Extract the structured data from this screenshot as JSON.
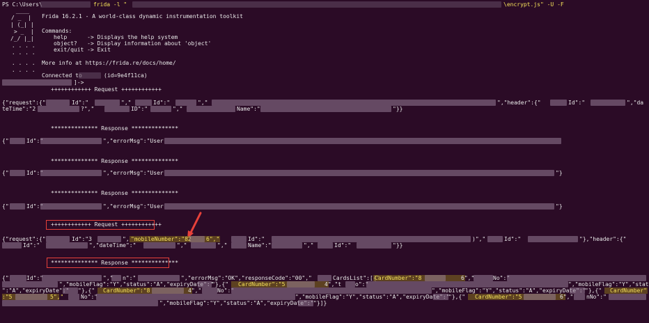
{
  "terminal": {
    "prompt": "PS C:\\Users\\",
    "cmd_frida": "frida -l \"",
    "cmd_script": "\\encrypt.js\" -U -F",
    "logo": [
      " ____",
      "/ _  |",
      "| (_| |",
      " > _  |",
      "/_/ |_|",
      " . . . .",
      " . . . .",
      " . . . .",
      " . . . ."
    ],
    "banner": "Frida 16.2.1 - A world-class dynamic instrumentation toolkit",
    "commands_header": "Commands:",
    "cmd_help": "help      -> Displays the help system",
    "cmd_object": "object?   -> Display information about 'object'",
    "cmd_exit": "exit/quit -> Exit",
    "more_info": "More info at https://frida.re/docs/home/",
    "connected": "Connected to",
    "connected_id": "(id=9e4f11ca)",
    "device_prompt": "]->",
    "request_header": "++++++++++++ Request ++++++++++++",
    "response_header": "************** Response **************",
    "req1_a": "{\"request\":{\"",
    "req1_b": "Id\":\"",
    "req1_c": "\",\"",
    "req1_d": "Id\":\"",
    "req1_e": "\",\"",
    "req1_f": "\",\"header\":{\"",
    "req1_g": "Id\":\"",
    "req1_h": "\",\"da",
    "req1_line2a": "teTime\":\"2",
    "req1_line2b": "?\",\"",
    "req1_line2c": "ID\":\"",
    "req1_line2d": "\",\"",
    "req1_line2e": "Name\":\"",
    "req1_line2f": "\"}}",
    "resp_a": "{\"",
    "resp_b": "Id\":\"",
    "resp_c": "\",\"errorMsg\":\"User",
    "resp_end": "\"}",
    "req2_a": "{\"request\":{\"",
    "req2_b": "Id\":\"3",
    "req2_c": "\",",
    "req2_mobile": "\"mobileNumber\":\"82",
    "req2_mobile_end": "6\",\"",
    "req2_d": "Id\":\"",
    "req2_e": ")\",\"",
    "req2_f": "Id\":\"",
    "req2_g": "\"},\"header\":{\"",
    "req2_line2a": "Id\":\"",
    "req2_line2b": "\",\"dateTime\":\"",
    "req2_line2c": "\",\"",
    "req2_line2d": "\",\"",
    "req2_line2e": "Name\":\"",
    "req2_line2f": "\",\"",
    "req2_line2g": "Id\":\"",
    "req2_line2h": "\"}}",
    "resp4_a": "{\"",
    "resp4_b": "Id\":\"",
    "resp4_c": "\",\"",
    "resp4_d": "n\":\"",
    "resp4_e": "\",\"errorMsg\":\"OK\",\"responseCode\":\"00\",\"",
    "resp4_f": "CardsList\":[{\"",
    "card_label": "CardNumber\":\"8",
    "card_end_6": "6\",\"",
    "no_label": "No\":\"",
    "l2_a": "\",\"mobileFlag\":\"Y\",\"status\":\"A\",\"expiryDate\":\"",
    "l2_b": "\"},{\"",
    "card_5": "CardNumber\":\"5",
    "card_4": "4\",\"t",
    "l2_c": "o\":\"",
    "l2_d": "\",\"mobileFlag\":\"Y\",\"status",
    "l3_a": "\":\"A\",\"expiryDate\":\"",
    "l3_b": "\"},{\"",
    "card_8b": "CardNumber\":\"8",
    "card_4b": "4\",\"",
    "l3_c": "No\":\"",
    "l3_d": "\",\"mobileFlag\":\"Y\",\"status\":\"A\",\"expiryDate\":\"",
    "l3_e": "\"},{\"",
    "l3_card": "CardNumber\"",
    "l4_a": ":\"5",
    "l4_b": "5\",\"",
    "l4_c": "No\":\"",
    "l4_d": "\",\"mobileFlag\":\"Y\",\"status\":\"A\",\"expiryDate\":\"",
    "l4_e": "\"},{\"",
    "card_5c": "CardNumber\":\"5",
    "card_6c": "6\",\"",
    "l4_f": "nNo\":\"",
    "l5_a": "\",\"mobileFlag\":\"Y\",\"status\":\"A\",\"expiryDate\":\"",
    "l5_b": "\"}]}"
  },
  "colors": {
    "background": "#2b0b26",
    "text": "#e8e8e8",
    "highlight": "#f5e25a",
    "annotation": "#e8413a"
  }
}
